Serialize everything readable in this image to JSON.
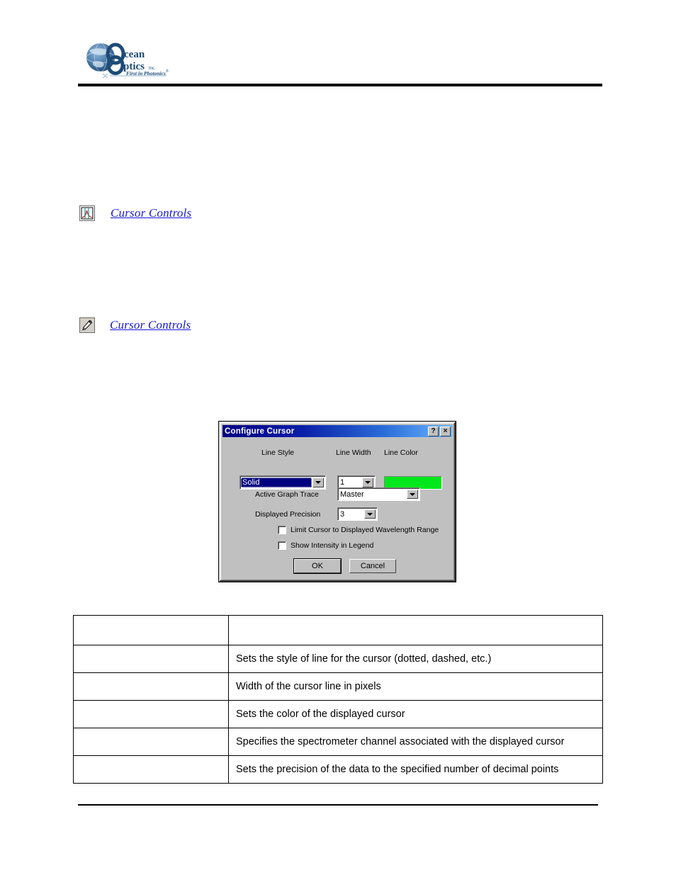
{
  "header": {
    "logo_primary": "Ocean",
    "logo_secondary": "Optics",
    "logo_suffix": "Inc.",
    "logo_tagline": "First in Photonics",
    "logo_alt": "Ocean Optics Inc. logo"
  },
  "links": [
    {
      "icon": "spectrum-graph-icon",
      "label": "Cursor Controls"
    },
    {
      "icon": "wrench-tool-icon",
      "label": "Cursor Controls"
    }
  ],
  "dialog": {
    "title": "Configure Cursor",
    "help_button": "?",
    "close_button": "×",
    "labels": {
      "line_style": "Line Style",
      "line_width": "Line Width",
      "line_color": "Line Color",
      "active_graph_trace": "Active Graph Trace",
      "displayed_precision": "Displayed Precision"
    },
    "values": {
      "line_style": "Solid",
      "line_width": "1",
      "line_color_hex": "#00E81B",
      "active_graph_trace": "Master",
      "displayed_precision": "3"
    },
    "checkboxes": [
      {
        "label": "Limit Cursor to Displayed Wavelength Range",
        "checked": false
      },
      {
        "label": "Show Intensity in Legend",
        "checked": false
      }
    ],
    "buttons": {
      "ok": "OK",
      "cancel": "Cancel"
    },
    "colors": {
      "face": "#C0C0C0",
      "titlebar_start": "#000082",
      "titlebar_end": "#69B5FF",
      "selection": "#000080"
    }
  },
  "table": {
    "header": {
      "col1": "",
      "col2": ""
    },
    "rows": [
      {
        "name": "",
        "description": "Sets the style of line for the cursor (dotted, dashed, etc.)"
      },
      {
        "name": "",
        "description": "Width of the cursor line in pixels"
      },
      {
        "name": "",
        "description": "Sets the color of the displayed cursor"
      },
      {
        "name": "",
        "description": "Specifies the spectrometer channel associated with the displayed cursor"
      },
      {
        "name": "",
        "description": "Sets the precision of the data to the specified number of decimal points"
      }
    ]
  }
}
